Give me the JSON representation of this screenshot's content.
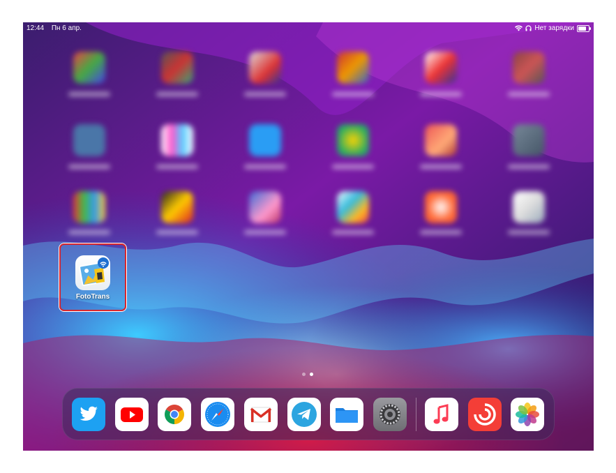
{
  "status_bar": {
    "time": "12:44",
    "date": "Пн 6 апр.",
    "charging_text": "Нет зарядки",
    "battery_level": 0.75
  },
  "home": {
    "highlighted_app": {
      "label": "FotoTrans",
      "icon": "fototrans-icon"
    },
    "page_count": 2,
    "active_page": 2
  },
  "dock": {
    "apps": [
      "twitter-icon",
      "youtube-icon",
      "chrome-icon",
      "safari-icon",
      "gmail-icon",
      "telegram-icon",
      "files-icon",
      "settings-icon"
    ],
    "recent_apps": [
      "music-icon",
      "pocket-casts-icon",
      "photos-icon"
    ]
  },
  "colors": {
    "highlight": "#d8262e"
  }
}
